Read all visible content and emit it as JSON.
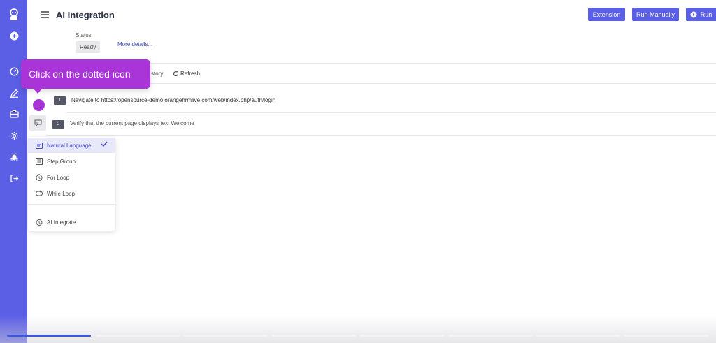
{
  "header": {
    "title": "AI Integration",
    "extension_label": "Extension",
    "run_manually_label": "Run Manually",
    "run_label": "Run"
  },
  "status": {
    "label": "Status",
    "value": "Ready",
    "more_details": "More details..."
  },
  "tabs": {
    "history_partial": "story",
    "refresh": "Refresh"
  },
  "steps": [
    {
      "number": "1",
      "text": "Navigate to  https://opensource-demo.orangehrmlive.com/web/index.php/auth/login"
    },
    {
      "number": "2",
      "text": "Verify that the current page displays text Welcome"
    }
  ],
  "tooltip": {
    "text": "Click on the dotted icon"
  },
  "menu": {
    "items": [
      {
        "label": "Natural Language",
        "icon": "natural-language-icon",
        "selected": true
      },
      {
        "label": "Step Group",
        "icon": "step-group-icon",
        "selected": false
      },
      {
        "label": "For Loop",
        "icon": "for-loop-icon",
        "selected": false
      },
      {
        "label": "While Loop",
        "icon": "while-loop-icon",
        "selected": false
      },
      {
        "label": "AI Integrate",
        "icon": "ai-integrate-icon",
        "selected": false
      }
    ]
  },
  "sidebar": {
    "icons": [
      "logo-icon",
      "add-icon",
      "dashboard-icon",
      "edit-icon",
      "briefcase-icon",
      "settings-icon",
      "bug-icon",
      "logout-icon"
    ]
  },
  "colors": {
    "sidebar": "#5b5fe6",
    "primary_button": "#5b5fe6",
    "tooltip": "#a935d8",
    "menu_active_bg": "#e8e8fb",
    "progress_done": "#3b57d6"
  },
  "video_progress": {
    "segments": 8,
    "completed_fraction_of_first": 1.0,
    "current_segment": 1
  }
}
